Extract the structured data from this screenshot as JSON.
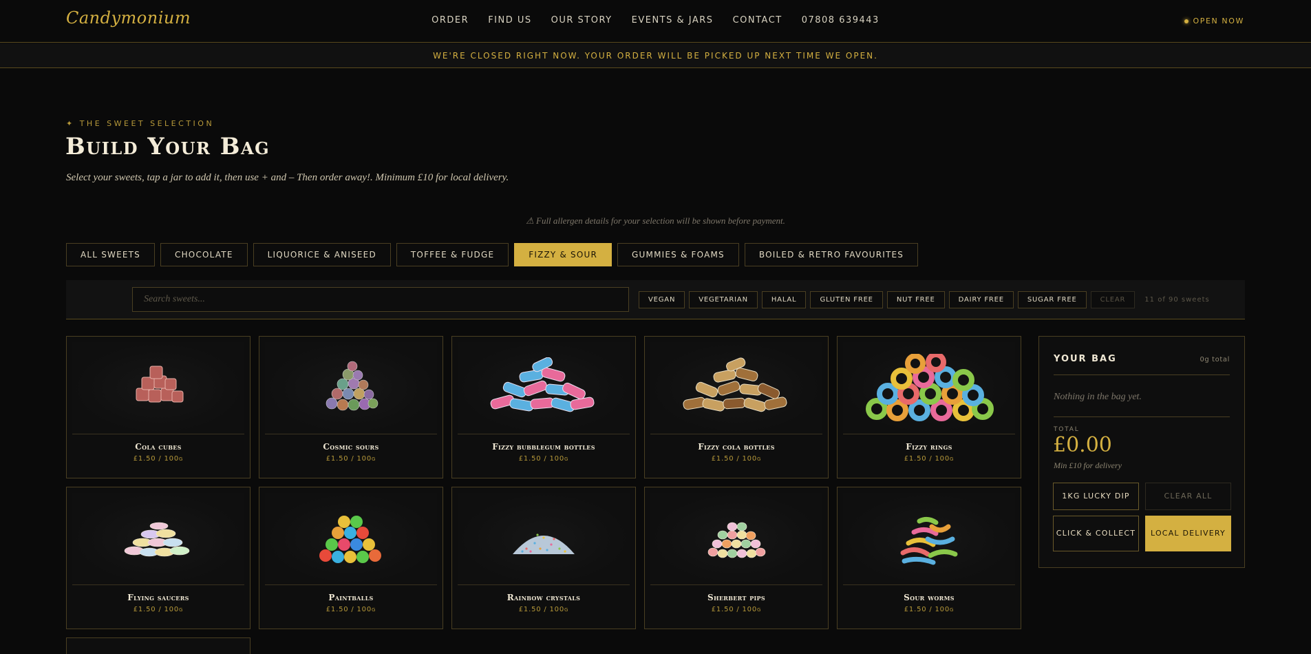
{
  "header": {
    "logo": "Candymonium",
    "nav": [
      "ORDER",
      "FIND US",
      "OUR STORY",
      "EVENTS & JARS",
      "CONTACT",
      "07808 639443"
    ],
    "status": "OPEN NOW"
  },
  "notice": "WE'RE CLOSED RIGHT NOW. YOUR ORDER WILL BE PICKED UP NEXT TIME WE OPEN.",
  "hero": {
    "eyebrow": "✦ THE SWEET SELECTION",
    "title": "Build Your Bag",
    "subtitle": "Select your sweets, tap a jar to add it, then use + and – Then order away!. Minimum £10 for local delivery."
  },
  "allergen_note": "⚠ Full allergen details for your selection will be shown before payment.",
  "tabs": [
    {
      "label": "ALL SWEETS",
      "active": false
    },
    {
      "label": "CHOCOLATE",
      "active": false
    },
    {
      "label": "LIQUORICE & ANISEED",
      "active": false
    },
    {
      "label": "TOFFEE & FUDGE",
      "active": false
    },
    {
      "label": "FIZZY & SOUR",
      "active": true
    },
    {
      "label": "GUMMIES & FOAMS",
      "active": false
    },
    {
      "label": "BOILED & RETRO FAVOURITES",
      "active": false
    }
  ],
  "search": {
    "placeholder": "Search sweets..."
  },
  "filters": [
    "VEGAN",
    "VEGETARIAN",
    "HALAL",
    "GLUTEN FREE",
    "NUT FREE",
    "DAIRY FREE",
    "SUGAR FREE"
  ],
  "filters_clear": "CLEAR",
  "result_count": "11 of 90 sweets",
  "products": [
    {
      "name": "Cola cubes",
      "price": "£1.50 / 100g",
      "icon": "cola-cubes-icon"
    },
    {
      "name": "Cosmic sours",
      "price": "£1.50 / 100g",
      "icon": "cosmic-sours-icon"
    },
    {
      "name": "Fizzy bubblegum bottles",
      "price": "£1.50 / 100g",
      "icon": "bubblegum-bottles-icon"
    },
    {
      "name": "Fizzy cola bottles",
      "price": "£1.50 / 100g",
      "icon": "cola-bottles-icon"
    },
    {
      "name": "Fizzy rings",
      "price": "£1.50 / 100g",
      "icon": "fizzy-rings-icon"
    },
    {
      "name": "Flying saucers",
      "price": "£1.50 / 100g",
      "icon": "flying-saucers-icon"
    },
    {
      "name": "Paintballs",
      "price": "£1.50 / 100g",
      "icon": "paintballs-icon"
    },
    {
      "name": "Rainbow crystals",
      "price": "£1.50 / 100g",
      "icon": "rainbow-crystals-icon"
    },
    {
      "name": "Sherbert pips",
      "price": "£1.50 / 100g",
      "icon": "sherbert-pips-icon"
    },
    {
      "name": "Sour worms",
      "price": "£1.50 / 100g",
      "icon": "sour-worms-icon"
    }
  ],
  "bag": {
    "title": "YOUR BAG",
    "weight": "0g total",
    "empty": "Nothing in the bag yet.",
    "total_label": "TOTAL",
    "total": "£0.00",
    "total_note": "Min £10 for delivery",
    "lucky_dip": "1KG LUCKY DIP",
    "clear_all": "CLEAR ALL",
    "click_collect": "CLICK & COLLECT",
    "local_delivery": "LOCAL DELIVERY"
  },
  "colors": {
    "accent": "#d4b041",
    "background": "#0a0a0a",
    "border": "#4a3f22"
  }
}
